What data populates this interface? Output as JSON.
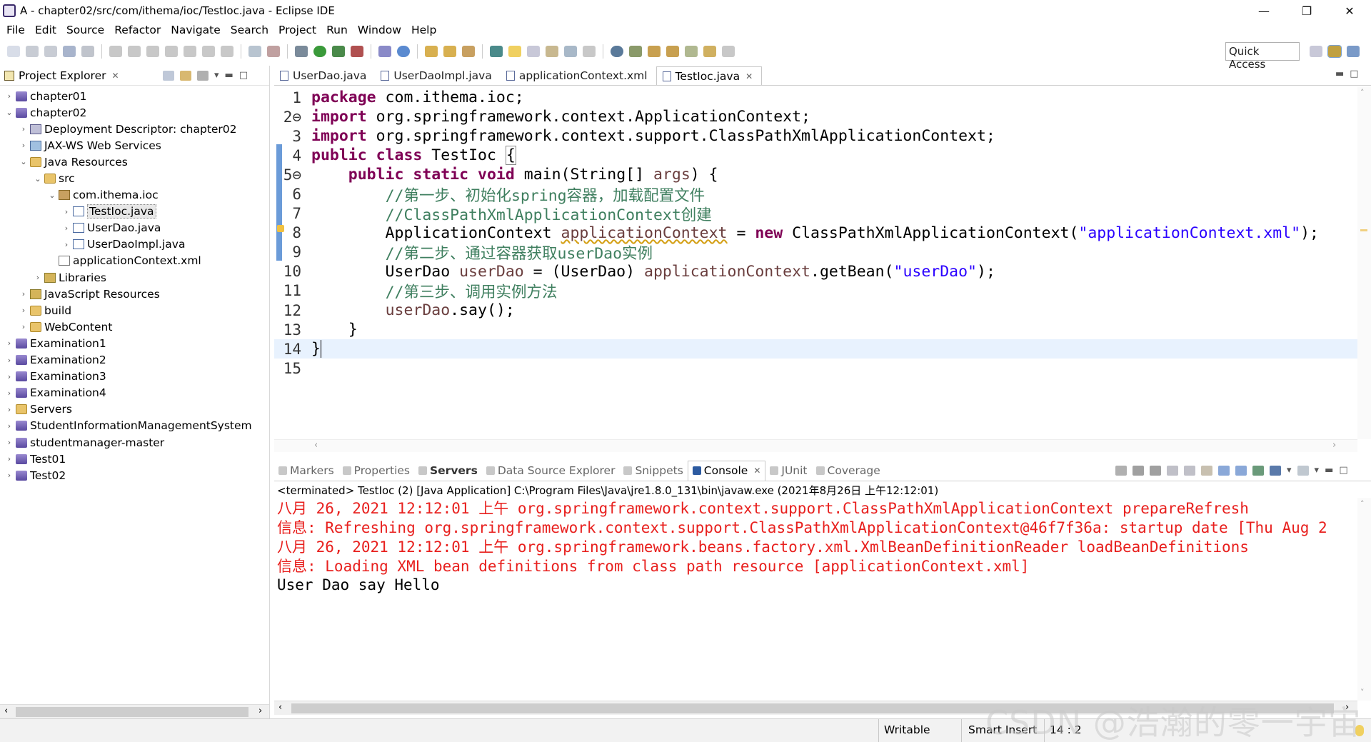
{
  "window": {
    "title": "A - chapter02/src/com/ithema/ioc/TestIoc.java - Eclipse IDE",
    "minimize": "—",
    "restore": "❐",
    "close": "✕"
  },
  "menu": [
    "File",
    "Edit",
    "Source",
    "Refactor",
    "Navigate",
    "Search",
    "Project",
    "Run",
    "Window",
    "Help"
  ],
  "toolbar": {
    "quick_access": "Quick Access"
  },
  "explorer": {
    "title": "Project Explorer",
    "close": "✕",
    "items": [
      {
        "label": "chapter01",
        "depth": 0,
        "twisty": "›",
        "icon": "project"
      },
      {
        "label": "chapter02",
        "depth": 0,
        "twisty": "⌄",
        "icon": "project"
      },
      {
        "label": "Deployment Descriptor: chapter02",
        "depth": 1,
        "twisty": "›",
        "icon": "desc"
      },
      {
        "label": "JAX-WS Web Services",
        "depth": 1,
        "twisty": "›",
        "icon": "ws"
      },
      {
        "label": "Java Resources",
        "depth": 1,
        "twisty": "⌄",
        "icon": "folder"
      },
      {
        "label": "src",
        "depth": 2,
        "twisty": "⌄",
        "icon": "folder"
      },
      {
        "label": "com.ithema.ioc",
        "depth": 3,
        "twisty": "⌄",
        "icon": "pkg"
      },
      {
        "label": "TestIoc.java",
        "depth": 4,
        "twisty": "›",
        "icon": "java",
        "selected": true
      },
      {
        "label": "UserDao.java",
        "depth": 4,
        "twisty": "›",
        "icon": "java"
      },
      {
        "label": "UserDaoImpl.java",
        "depth": 4,
        "twisty": "›",
        "icon": "java"
      },
      {
        "label": "applicationContext.xml",
        "depth": 3,
        "twisty": "",
        "icon": "xml"
      },
      {
        "label": "Libraries",
        "depth": 2,
        "twisty": "›",
        "icon": "lib"
      },
      {
        "label": "JavaScript Resources",
        "depth": 1,
        "twisty": "›",
        "icon": "lib"
      },
      {
        "label": "build",
        "depth": 1,
        "twisty": "›",
        "icon": "folder"
      },
      {
        "label": "WebContent",
        "depth": 1,
        "twisty": "›",
        "icon": "folder"
      },
      {
        "label": "Examination1",
        "depth": 0,
        "twisty": "›",
        "icon": "project"
      },
      {
        "label": "Examination2",
        "depth": 0,
        "twisty": "›",
        "icon": "project"
      },
      {
        "label": "Examination3",
        "depth": 0,
        "twisty": "›",
        "icon": "project"
      },
      {
        "label": "Examination4",
        "depth": 0,
        "twisty": "›",
        "icon": "project"
      },
      {
        "label": "Servers",
        "depth": 0,
        "twisty": "›",
        "icon": "folder"
      },
      {
        "label": "StudentInformationManagementSystem",
        "depth": 0,
        "twisty": "›",
        "icon": "project"
      },
      {
        "label": "studentmanager-master",
        "depth": 0,
        "twisty": "›",
        "icon": "project"
      },
      {
        "label": "Test01",
        "depth": 0,
        "twisty": "›",
        "icon": "project"
      },
      {
        "label": "Test02",
        "depth": 0,
        "twisty": "›",
        "icon": "project"
      }
    ]
  },
  "editor": {
    "tabs": [
      {
        "label": "UserDao.java",
        "active": false
      },
      {
        "label": "UserDaoImpl.java",
        "active": false
      },
      {
        "label": "applicationContext.xml",
        "active": false
      },
      {
        "label": "TestIoc.java",
        "active": true
      }
    ],
    "current_line": 14,
    "lines": [
      {
        "n": "1",
        "html": "<span class='kw'>package</span> com.ithema.ioc;"
      },
      {
        "n": "2⊖",
        "html": "<span class='kw'>import</span> org.springframework.context.ApplicationContext;"
      },
      {
        "n": "3",
        "html": "<span class='kw'>import</span> org.springframework.context.support.ClassPathXmlApplicationContext;"
      },
      {
        "n": "4",
        "html": "<span class='kw'>public</span> <span class='kw'>class</span> TestIoc <span style='border:1px solid #888'>{</span>"
      },
      {
        "n": "5⊖",
        "html": "    <span class='kw'>public</span> <span class='kw'>static</span> <span class='kw'>void</span> main(String[] <span class='var'>args</span>) {"
      },
      {
        "n": "6",
        "html": "        <span class='cm'>//第一步、初始化spring容器，加载配置文件</span>"
      },
      {
        "n": "7",
        "html": "        <span class='cm'>//ClassPathXmlApplicationContext创建</span>"
      },
      {
        "n": "8",
        "html": "        ApplicationContext <span class='var' style='text-decoration: underline wavy #d4a017'>applicationContext</span> = <span class='kw'>new</span> ClassPathXmlApplicationContext(<span class='st'>\"applicationContext.xml\"</span>);"
      },
      {
        "n": "9",
        "html": "        <span class='cm'>//第二步、通过容器获取userDao实例</span>"
      },
      {
        "n": "10",
        "html": "        UserDao <span class='var'>userDao</span> = (UserDao) <span class='var'>applicationContext</span>.getBean(<span class='st'>\"userDao\"</span>);"
      },
      {
        "n": "11",
        "html": "        <span class='cm'>//第三步、调用实例方法</span>"
      },
      {
        "n": "12",
        "html": "        <span class='var'>userDao</span>.say();"
      },
      {
        "n": "13",
        "html": "    }"
      },
      {
        "n": "14",
        "html": "}<span style='border-left:1.5px solid #000'></span>"
      },
      {
        "n": "15",
        "html": ""
      }
    ]
  },
  "console": {
    "tabs": [
      {
        "label": "Markers",
        "active": false,
        "bold": false
      },
      {
        "label": "Properties",
        "active": false,
        "bold": false
      },
      {
        "label": "Servers",
        "active": false,
        "bold": true
      },
      {
        "label": "Data Source Explorer",
        "active": false,
        "bold": false
      },
      {
        "label": "Snippets",
        "active": false,
        "bold": false
      },
      {
        "label": "Console",
        "active": true,
        "bold": false
      },
      {
        "label": "JUnit",
        "active": false,
        "bold": false
      },
      {
        "label": "Coverage",
        "active": false,
        "bold": false
      }
    ],
    "terminated": "<terminated> TestIoc (2) [Java Application] C:\\Program Files\\Java\\jre1.8.0_131\\bin\\javaw.exe (2021年8月26日 上午12:12:01)",
    "lines": [
      {
        "text": "八月 26, 2021 12:12:01 上午 org.springframework.context.support.ClassPathXmlApplicationContext prepareRefresh",
        "type": "err"
      },
      {
        "text": "信息: Refreshing org.springframework.context.support.ClassPathXmlApplicationContext@46f7f36a: startup date [Thu Aug 2",
        "type": "err"
      },
      {
        "text": "八月 26, 2021 12:12:01 上午 org.springframework.beans.factory.xml.XmlBeanDefinitionReader loadBeanDefinitions",
        "type": "err"
      },
      {
        "text": "信息: Loading XML bean definitions from class path resource [applicationContext.xml]",
        "type": "err"
      },
      {
        "text": "User Dao say Hello",
        "type": "out"
      }
    ]
  },
  "status": {
    "writable": "Writable",
    "insert_mode": "Smart Insert",
    "position": "14 : 2"
  },
  "watermark": "CSDN @浩瀚的零一宇宙",
  "colors": {
    "keyword": "#7f0055",
    "comment": "#3f7f5f",
    "string": "#2a00ff",
    "console_error": "#e8201e",
    "current_line": "#e8f2fe"
  }
}
